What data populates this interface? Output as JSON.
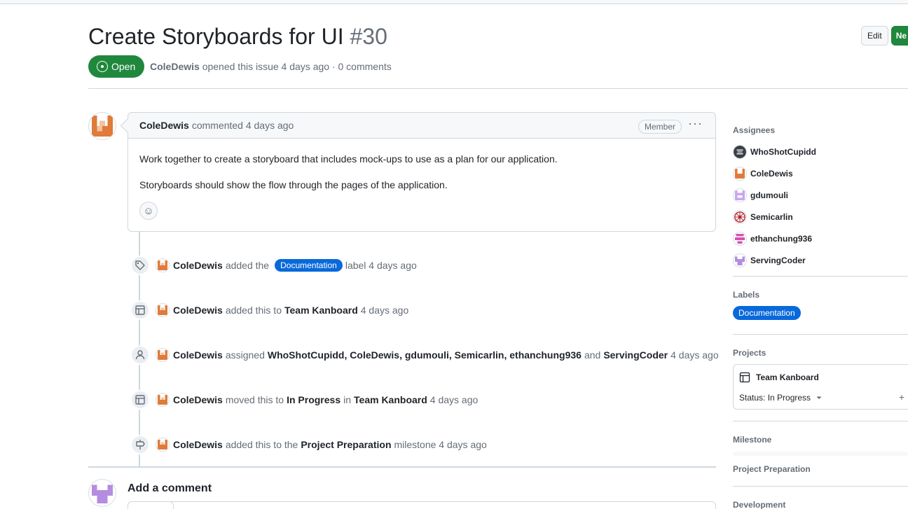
{
  "issue": {
    "title": "Create Storyboards for UI",
    "number": "#30",
    "state": "Open",
    "author": "ColeDewis",
    "meta_rest": "opened this issue 4 days ago · 0 comments"
  },
  "header_buttons": {
    "edit": "Edit",
    "new": "Ne"
  },
  "comment": {
    "author": "ColeDewis",
    "time": "commented 4 days ago",
    "badge": "Member",
    "menu": "···",
    "body": [
      "Work together to create a storyboard that includes mock-ups to use as a plan for our application.",
      "Storyboards should show the flow through the pages of the application."
    ],
    "reaction_icon": "☺"
  },
  "events": [
    {
      "icon": "tag-icon",
      "actor": "ColeDewis",
      "t1": "added the",
      "label": "Documentation",
      "t2": "label 4 days ago"
    },
    {
      "icon": "table-icon",
      "actor": "ColeDewis",
      "t1": "added this to",
      "target": "Team Kanboard",
      "t2": "4 days ago"
    },
    {
      "icon": "person-icon",
      "actor": "ColeDewis",
      "t1": "assigned",
      "users": [
        "WhoShotCupidd,",
        "ColeDewis,",
        "gdumouli,",
        "Semicarlin,",
        "ethanchung936"
      ],
      "and": "and",
      "last": "ServingCoder",
      "t2": "4 days ago"
    },
    {
      "icon": "table-icon",
      "actor": "ColeDewis",
      "t1": "moved this to",
      "status": "In Progress",
      "in": "in",
      "target": "Team Kanboard",
      "t2": "4 days ago"
    },
    {
      "icon": "milestone-icon",
      "actor": "ColeDewis",
      "t1": "added this to the",
      "target": "Project Preparation",
      "t2": "milestone 4 days ago"
    }
  ],
  "add_comment": "Add a comment",
  "sidebar": {
    "assignees_h": "Assignees",
    "assignees": [
      "WhoShotCupidd",
      "ColeDewis",
      "gdumouli",
      "Semicarlin",
      "ethanchung936",
      "ServingCoder"
    ],
    "labels_h": "Labels",
    "label": "Documentation",
    "projects_h": "Projects",
    "project": "Team Kanboard",
    "project_status": "Status: In Progress",
    "project_plus": "+",
    "milestone_h": "Milestone",
    "milestone": "Project Preparation",
    "development_h": "Development"
  },
  "colors": {
    "green": "#1f883d",
    "blue": "#0969da",
    "orange": "#e07b39"
  }
}
